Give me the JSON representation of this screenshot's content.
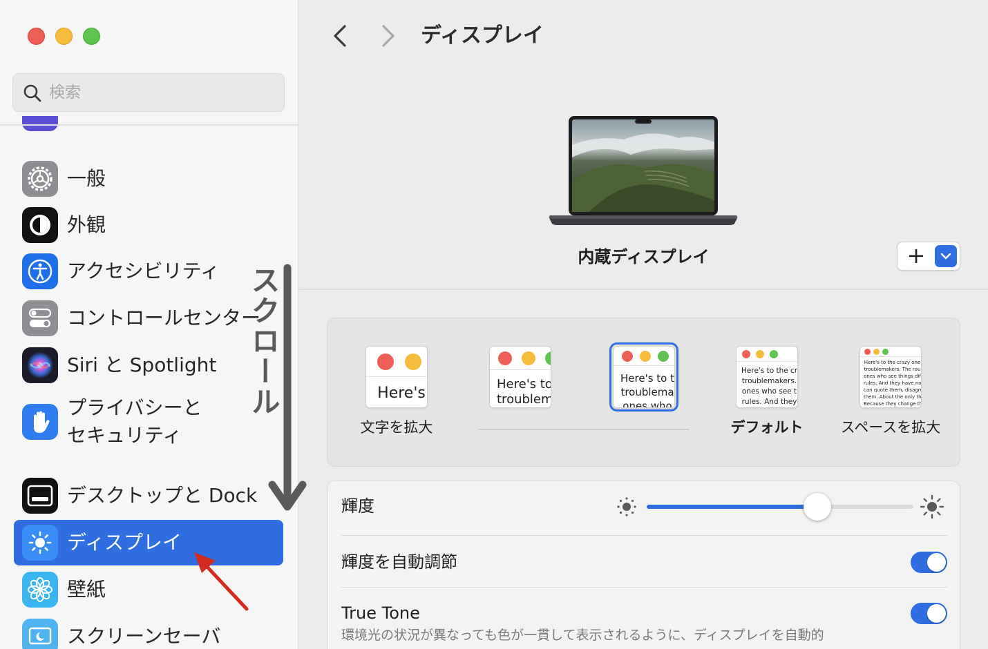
{
  "window": {
    "traffic_lights": {
      "close": "#ee5f57",
      "minimize": "#f5bd3b",
      "zoom": "#5fc44f"
    }
  },
  "search": {
    "placeholder": "検索",
    "icon": "search-icon"
  },
  "sidebar": {
    "items": [
      {
        "id": "general",
        "label": "一般",
        "icon": "gear-icon"
      },
      {
        "id": "appearance",
        "label": "外観",
        "icon": "appearance-icon"
      },
      {
        "id": "accessibility",
        "label": "アクセシビリティ",
        "icon": "accessibility-icon"
      },
      {
        "id": "control-center",
        "label": "コントロールセンター",
        "icon": "toggles-icon"
      },
      {
        "id": "siri",
        "label": "Siri と Spotlight",
        "icon": "siri-icon"
      },
      {
        "id": "privacy",
        "label_line1": "プライバシーと",
        "label_line2": "セキュリティ",
        "icon": "hand-icon"
      },
      {
        "id": "desktop-dock",
        "label": "デスクトップと Dock",
        "icon": "dock-icon"
      },
      {
        "id": "displays",
        "label": "ディスプレイ",
        "icon": "sun-icon",
        "selected": true
      },
      {
        "id": "wallpaper",
        "label": "壁紙",
        "icon": "flower-icon"
      },
      {
        "id": "screensaver",
        "label": "スクリーンセーバ",
        "icon": "screensaver-icon"
      }
    ],
    "selected_color": "#2f6de1"
  },
  "annotation": {
    "scroll_label": "スクロール"
  },
  "main": {
    "title": "ディスプレイ",
    "display_name": "内蔵ディスプレイ",
    "add_label": "+",
    "resolution_options": [
      {
        "label": "文字を拡大",
        "sample": "Here's"
      },
      {
        "label": "",
        "sample": "Here's to\ntroublem"
      },
      {
        "label": "",
        "sample": "Here's to t\ntroublema\nones who",
        "selected": true
      },
      {
        "label": "デフォルト",
        "sample": "Here's to the cr\ntroublemakers.\nones who see t\nrules. And they"
      },
      {
        "label": "スペースを拡大",
        "sample": "Here's to the crazy one\ntroublemakers. The rou\nones who see things dif\nrules. And they have no\ncan quote them, disagre\nthem. About the only th\nBecause they change th"
      }
    ],
    "brightness": {
      "label": "輝度",
      "value": 0.64
    },
    "auto_brightness": {
      "label": "輝度を自動調節",
      "on": true
    },
    "true_tone": {
      "label": "True Tone",
      "on": true,
      "description": "環境光の状況が異なっても色が一貫して表示されるように、ディスプレイを自動的"
    },
    "accent_color": "#2f6de1"
  }
}
